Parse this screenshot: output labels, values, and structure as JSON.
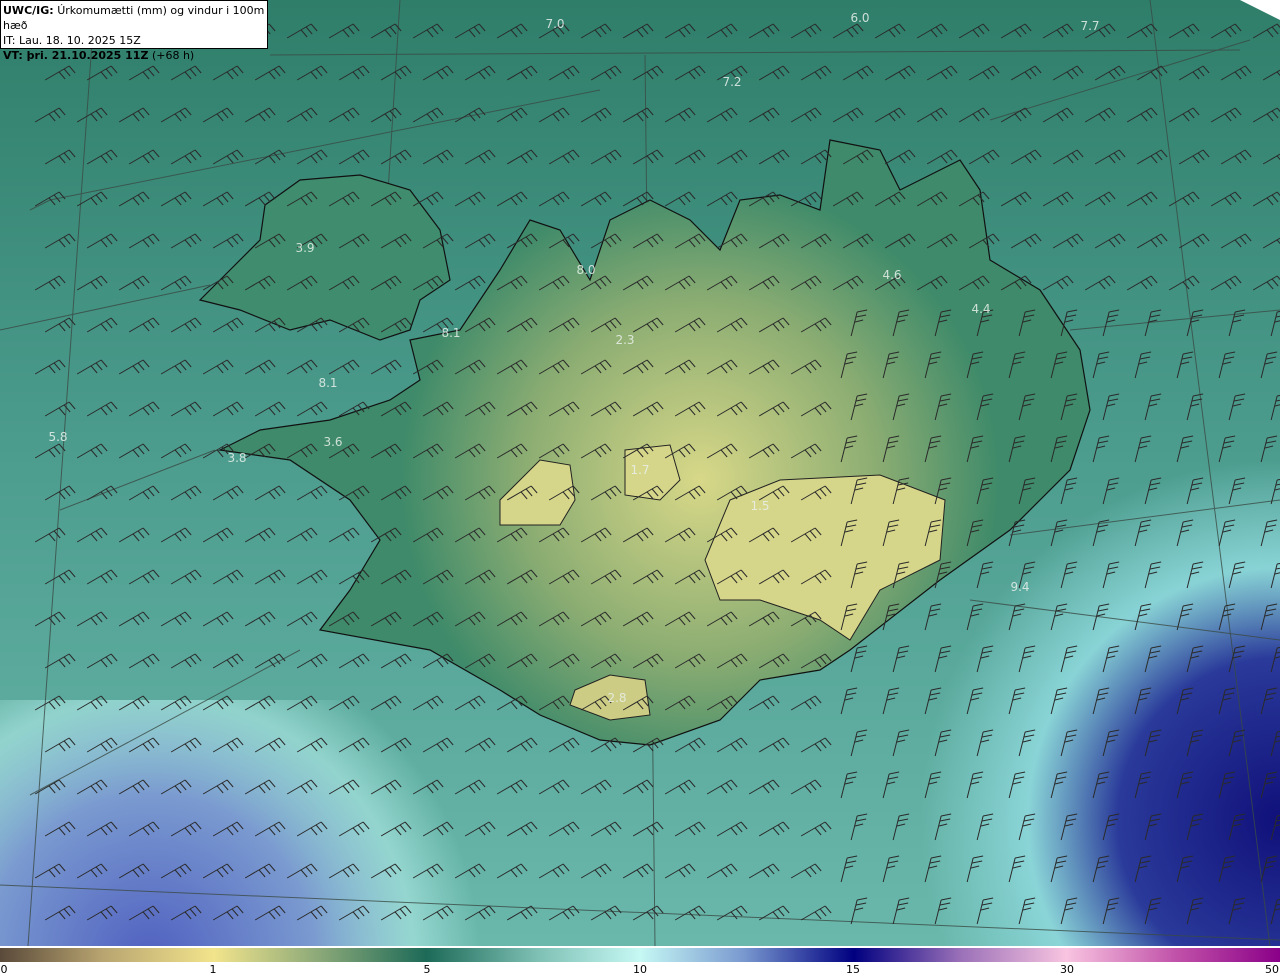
{
  "header": {
    "model": "UWC/IG:",
    "title": "Úrkomumætti (mm) og vindur i 100m hæð",
    "issue_time": "IT: Lau. 18. 10. 2025 15Z",
    "valid_label": "VT: þri. 21.10.2025 11Z",
    "lead": "(+68 h)"
  },
  "map": {
    "labels": [
      "7.0",
      "6.0",
      "7.7",
      "7.2",
      "3.9",
      "8.0",
      "8.1",
      "2.3",
      "4.6",
      "4.4",
      "8.1",
      "5.8",
      "3.6",
      "3.8",
      "1.7",
      "1.5",
      "9.4",
      "2.8"
    ]
  },
  "colorbar": {
    "ticks": [
      "0",
      "1",
      "5",
      "10",
      "15",
      "30",
      "50"
    ],
    "colors": [
      "#5a4a3a",
      "#f2e48c",
      "#1d6a58",
      "#c6f8f4",
      "#000080",
      "#f8c4e0",
      "#8a0088"
    ]
  }
}
